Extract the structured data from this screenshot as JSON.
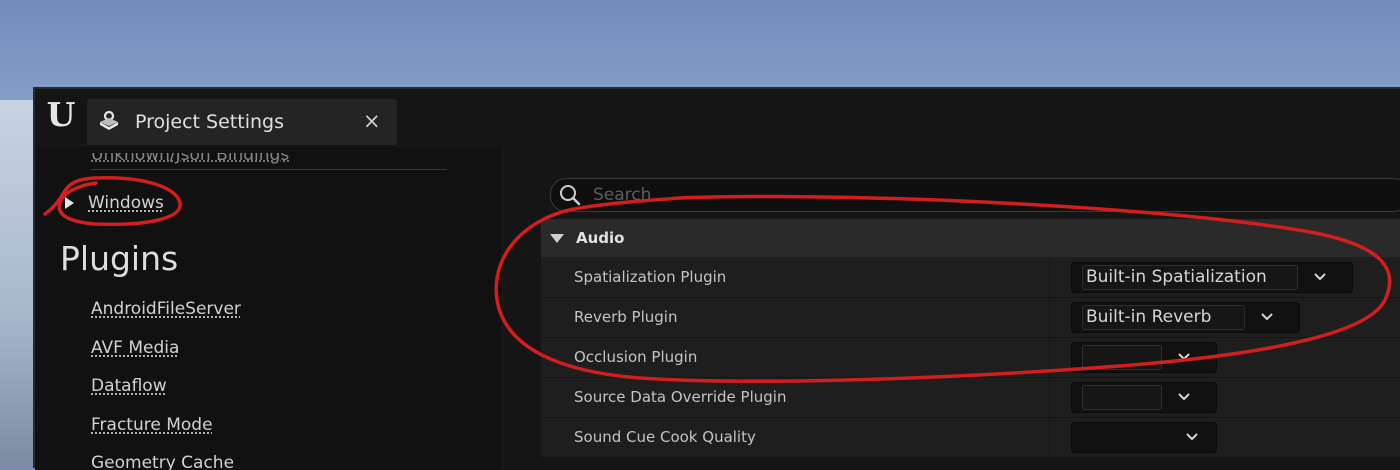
{
  "window": {
    "tab_title": "Project Settings",
    "close_glyph": "×",
    "logo_glyph": "U"
  },
  "sidebar": {
    "cut_item": "Unknown/Json Bindings",
    "windows_label": "Windows",
    "section_title": "Plugins",
    "plugins": [
      "AndroidFileServer",
      "AVF Media",
      "Dataflow",
      "Fracture Mode",
      "Geometry Cache"
    ]
  },
  "search": {
    "placeholder": "Search"
  },
  "category": {
    "label": "Audio",
    "rows": [
      {
        "label": "Spatialization Plugin",
        "value": "Built-in Spatialization"
      },
      {
        "label": "Reverb Plugin",
        "value": "Built-in Reverb"
      },
      {
        "label": "Occlusion Plugin",
        "value": ""
      },
      {
        "label": "Source Data Override Plugin",
        "value": ""
      },
      {
        "label": "Sound Cue Cook Quality",
        "value": ""
      }
    ]
  },
  "colors": {
    "annotation": "#d11f1f",
    "panel_bg": "#151515",
    "sidebar_bg": "#111111"
  },
  "icons": {
    "logo": "unreal-logo-icon",
    "tab": "project-settings-icon",
    "close": "close-icon",
    "search": "search-icon",
    "expand": "triangle-right-icon",
    "collapse": "triangle-down-icon",
    "dropdown": "chevron-down-icon"
  }
}
